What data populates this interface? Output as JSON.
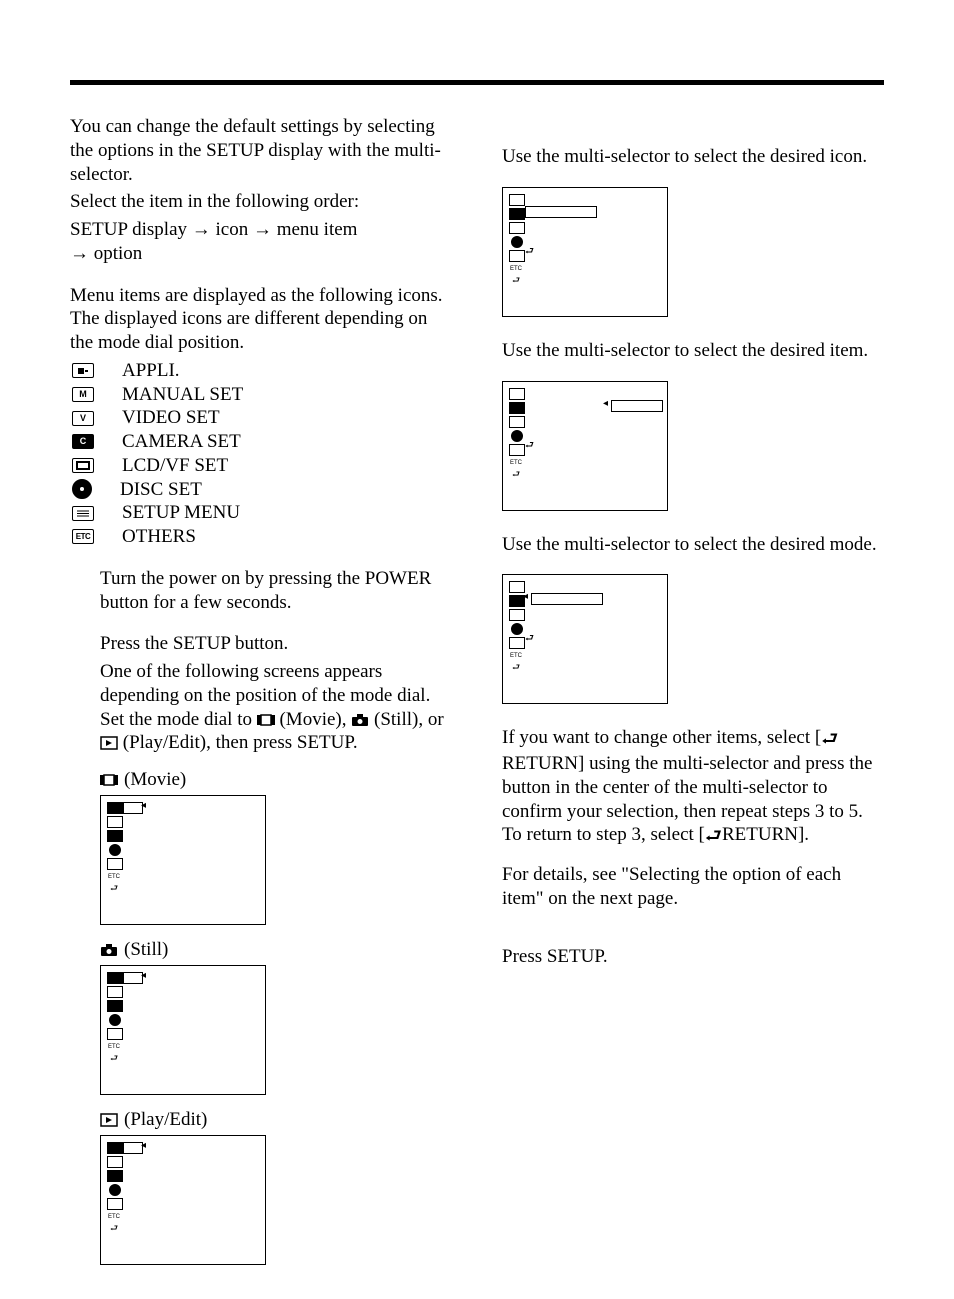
{
  "intro": {
    "p1": "You can change the default settings by selecting the options in the SETUP display with the multi-selector.",
    "p2": "Select the item in the following order:",
    "p3a": "SETUP display ",
    "arrow": "→",
    "p3b": " icon ",
    "p3c": " menu item",
    "p3d": " option",
    "p4": "Menu items are displayed as the following icons. The displayed icons are different depending on the mode dial position."
  },
  "iconList": [
    {
      "label": "APPLI."
    },
    {
      "label": "MANUAL SET"
    },
    {
      "label": "VIDEO SET"
    },
    {
      "label": "CAMERA SET"
    },
    {
      "label": "LCD/VF SET"
    },
    {
      "label": "DISC SET"
    },
    {
      "label": "SETUP MENU"
    },
    {
      "label": "OTHERS"
    }
  ],
  "steps": {
    "s1": "Turn the power on by pressing the POWER button for a few seconds.",
    "s2a": "Press the SETUP button.",
    "s2b_1": "One of the following screens appears depending on the position of the mode dial. Set the mode dial to ",
    "s2b_2": " (Movie), ",
    "s2b_3": " (Still), or ",
    "s2b_4": " (Play/Edit), then press SETUP."
  },
  "modes": {
    "movie": " (Movie)",
    "still": " (Still)",
    "play": " (Play/Edit)"
  },
  "right": {
    "r3": "Use the multi-selector to select the desired icon.",
    "r4": "Use the multi-selector to select the desired item.",
    "r5": "Use the multi-selector to select the desired mode.",
    "r6a": "If you want to change other items, select [",
    "r6b": "RETURN] using the multi-selector and press the button in the center of the multi-selector to confirm your selection, then repeat steps 3 to 5.",
    "r6c": "To return to step 3, select [",
    "r6d": "RETURN].",
    "details": "For details, see \"Selecting the option of each item\" on the next page.",
    "r7": "Press SETUP."
  }
}
